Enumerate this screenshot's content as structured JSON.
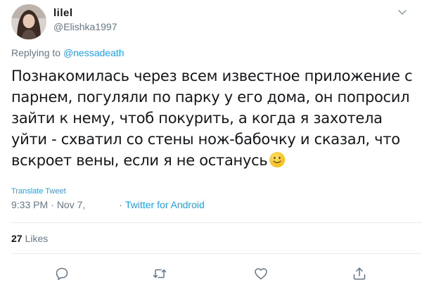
{
  "author": {
    "display_name": "lilel",
    "handle": "@Elishka1997"
  },
  "reply": {
    "prefix": "Replying to ",
    "mention": "@nessadeath"
  },
  "tweet": {
    "text": "Познакомилась через всем известное приложение с парнем, погуляли по парку у его дома, он попросил зайти к нему, чтоб покурить, а когда я захотела уйти - схватил со стены нож-бабочку и сказал, что вскроет вены, если я не останусь",
    "emoji": "slightly-smiling-face"
  },
  "translate_label": "Translate Tweet",
  "meta": {
    "time": "9:33 PM",
    "separator": "·",
    "date": "Nov 7,",
    "source": "Twitter for Android"
  },
  "stats": {
    "likes_count": "27",
    "likes_label": "Likes"
  },
  "icons": {
    "menu": "chevron-down-icon",
    "reply": "reply-icon",
    "retweet": "retweet-icon",
    "like": "heart-icon",
    "share": "share-icon"
  },
  "colors": {
    "text": "#14171a",
    "secondary": "#657786",
    "link": "#1da1f2",
    "divider": "#e6ecf0"
  }
}
